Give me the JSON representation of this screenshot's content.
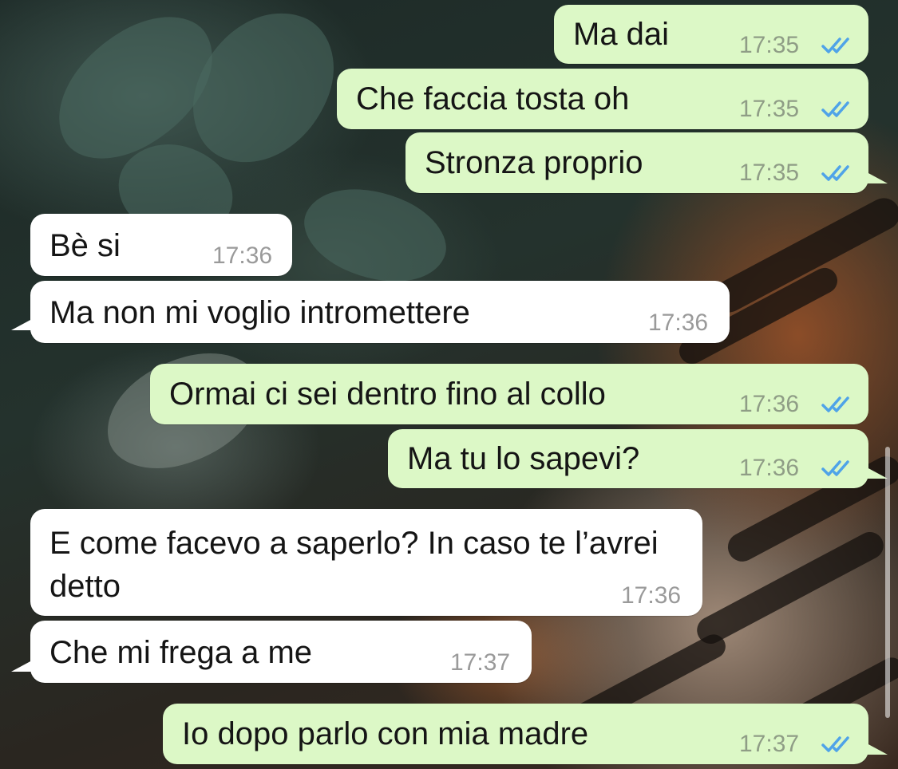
{
  "messages": [
    {
      "text": "Ma dai",
      "time": "17:35",
      "dir": "out",
      "read": true
    },
    {
      "text": "Che faccia tosta oh",
      "time": "17:35",
      "dir": "out",
      "read": true
    },
    {
      "text": "Stronza proprio",
      "time": "17:35",
      "dir": "out",
      "read": true
    },
    {
      "text": "Bè si",
      "time": "17:36",
      "dir": "in"
    },
    {
      "text": "Ma non mi voglio intromettere",
      "time": "17:36",
      "dir": "in"
    },
    {
      "text": "Ormai ci sei dentro fino al collo",
      "time": "17:36",
      "dir": "out",
      "read": true
    },
    {
      "text": "Ma tu lo sapevi?",
      "time": "17:36",
      "dir": "out",
      "read": true
    },
    {
      "text": "E come facevo a saperlo? In caso te l’avrei detto",
      "time": "17:36",
      "dir": "in"
    },
    {
      "text": "Che mi frega a me",
      "time": "17:37",
      "dir": "in"
    },
    {
      "text": "Io dopo parlo con mia madre",
      "time": "17:37",
      "dir": "out",
      "read": true
    }
  ],
  "colors": {
    "outgoing_bubble": "#dcf8c6",
    "incoming_bubble": "#ffffff",
    "read_ticks": "#4fa3e8",
    "timestamp": "#9a9a9a"
  },
  "icons": {
    "read_receipt": "double-check-icon"
  }
}
